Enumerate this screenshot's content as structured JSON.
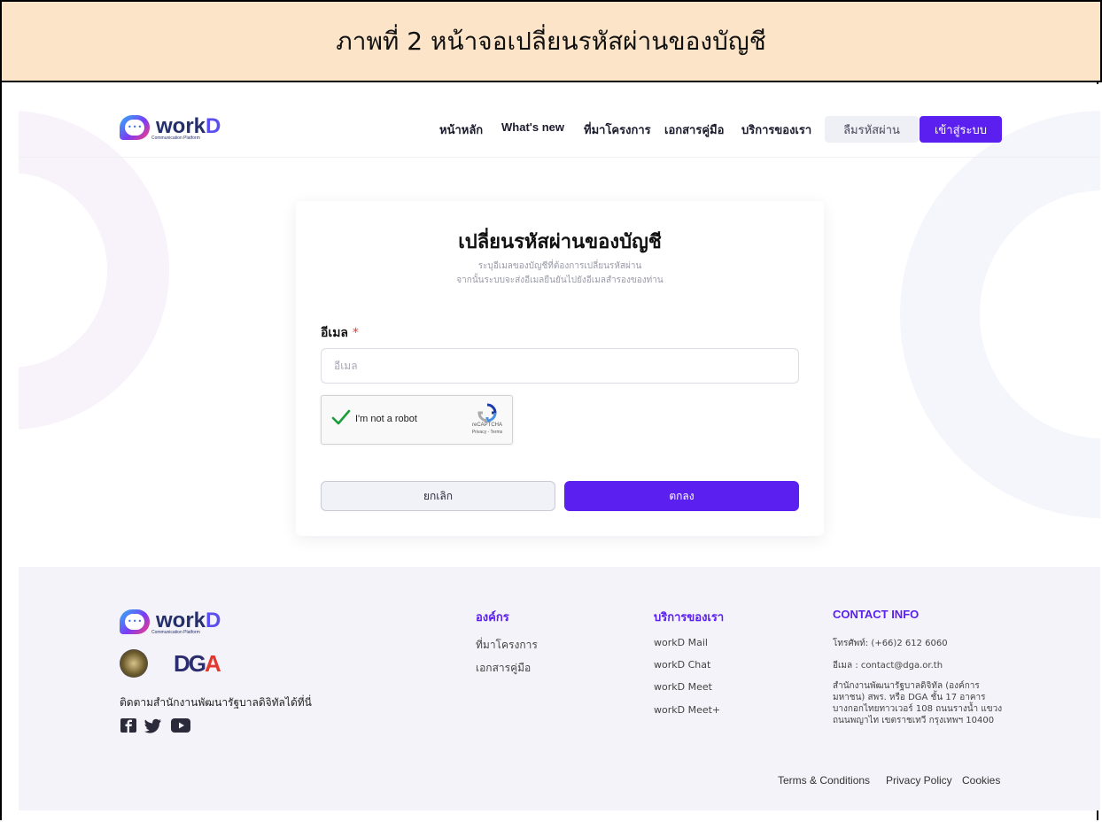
{
  "caption": {
    "text": "ภาพที่ 2 หน้าจอเปลี่ยนรหัสผ่านของบัญชี"
  },
  "header": {
    "logo_text": "work",
    "logo_text_d": "D",
    "logo_sub": "Communication Platform",
    "nav": [
      "หน้าหลัก",
      "What's new",
      "ที่มาโครงการ",
      "เอกสารคู่มือ",
      "บริการของเรา"
    ],
    "forgot_password": "ลืมรหัสผ่าน",
    "login": "เข้าสู่ระบบ"
  },
  "form": {
    "title": "เปลี่ยนรหัสผ่านของบัญชี",
    "subtitle_1": "ระบุอีเมลของบัญชีที่ต้องการเปลี่ยนรหัสผ่าน",
    "subtitle_2": "จากนั้นระบบจะส่งอีเมลยืนยันไปยังอีเมลสำรองของท่าน",
    "email_label": "อีเมล",
    "required_mark": "*",
    "email_value": "",
    "email_placeholder": "อีเมล",
    "captcha_label": "I'm not a robot",
    "captcha_brand": "reCAPTCHA",
    "captcha_links": "Privacy - Terms",
    "cancel": "ยกเลิก",
    "confirm": "ตกลง"
  },
  "footer": {
    "logo_text": "work",
    "logo_text_d": "D",
    "logo_sub": "Communication Platform",
    "dga_text_1": "DG",
    "dga_text_2": "A",
    "follow_text": "ติดตามสำนักงานพัฒนารัฐบาลดิจิทัลได้ที่นี่",
    "social_icons": [
      "facebook-icon",
      "twitter-icon",
      "youtube-icon"
    ],
    "org": {
      "title": "องค์กร",
      "items": [
        "ที่มาโครงการ",
        "เอกสารคู่มือ"
      ]
    },
    "services": {
      "title": "บริการของเรา",
      "items": [
        "workD Mail",
        "workD Chat",
        "workD Meet",
        "workD Meet+"
      ]
    },
    "contact": {
      "title": "CONTACT INFO",
      "phone": "โทรศัพท์: (+66)2 612 6060",
      "email": "อีเมล : contact@dga.or.th",
      "address_1": "สำนักงานพัฒนารัฐบาลดิจิทัล (องค์การ",
      "address_2": "มหาชน) สพร. หรือ DGA ชั้น 17 อาคาร",
      "address_3": "บางกอกไทยทาวเวอร์ 108 ถนนรางน้ำ แขวง",
      "address_4": "ถนนพญาไท เขตราชเทวี กรุงเทพฯ 10400"
    },
    "legal": [
      "Terms & Conditions",
      "Privacy Policy",
      "Cookies"
    ]
  },
  "colors": {
    "primary": "#5b1ff0",
    "caption_bg": "#fce4c9",
    "footer_bg": "#f4f3f9"
  }
}
